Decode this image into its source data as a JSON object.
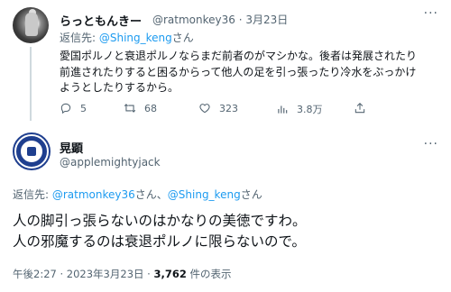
{
  "tweet1": {
    "name": "らっともんきー",
    "handle_date": "@ratmonkey36 · 3月23日",
    "more": "···",
    "reply_label": "返信先: ",
    "reply_handle": "@Shing_keng",
    "reply_suffix": "さん",
    "body": "愛国ポルノと衰退ポルノならまだ前者のがマシかな。後者は発展されたり\n前進されたりすると困るからって他人の足を引っ張ったり冷水をぶっかけ\nようとしたりするから。",
    "actions": {
      "reply": "5",
      "retweet": "68",
      "like": "323",
      "views": "3.8万"
    },
    "icons": [
      "reply-icon",
      "retweet-icon",
      "like-icon",
      "views-icon",
      "share-icon"
    ]
  },
  "tweet2": {
    "name": "晃顕",
    "handle": "@applemightyjack",
    "more": "···",
    "reply_label": "返信先: ",
    "reply_handle1": "@ratmonkey36",
    "reply_mid": "さん、",
    "reply_handle2": "@Shing_keng",
    "reply_suffix": "さん",
    "body": "人の脚引っ張らないのはかなりの美徳ですわ。\n人の邪魔するのは衰退ポルノに限らないので。",
    "time": "午後2:27 · 2023年3月23日 · ",
    "views_count": "3,762",
    "views_suffix": " 件の表示"
  },
  "colors": {
    "accent": "#1d9bf0",
    "muted": "#536471",
    "text": "#0f1419"
  }
}
